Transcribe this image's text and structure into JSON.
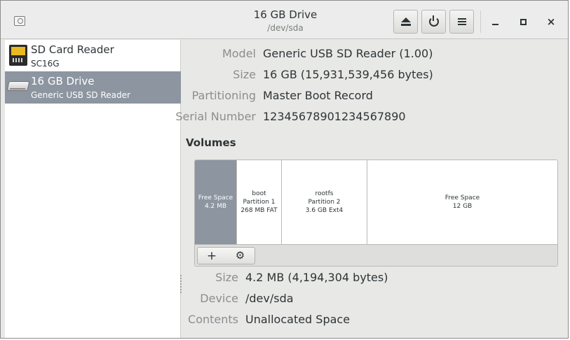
{
  "header": {
    "title": "16 GB Drive",
    "subtitle": "/dev/sda",
    "buttons": {
      "eject": "eject-icon",
      "power": "power-icon",
      "menu": "menu-icon"
    },
    "window_controls": {
      "close": "×"
    }
  },
  "sidebar": {
    "items": [
      {
        "name": "SD Card Reader",
        "sub": "SC16G",
        "icon": "sd-card-icon",
        "selected": false
      },
      {
        "name": "16 GB Drive",
        "sub": "Generic USB  SD Reader",
        "icon": "usb-drive-icon",
        "selected": true
      }
    ]
  },
  "drive": {
    "model_label": "Model",
    "model": "Generic USB  SD Reader (1.00)",
    "size_label": "Size",
    "size": "16 GB (15,931,539,456 bytes)",
    "partitioning_label": "Partitioning",
    "partitioning": "Master Boot Record",
    "serial_label": "Serial Number",
    "serial": "12345678901234567890"
  },
  "volumes": {
    "heading": "Volumes",
    "segments": [
      {
        "line1": "Free Space",
        "line2": "4.2 MB",
        "line3": "",
        "selected": true
      },
      {
        "line1": "boot",
        "line2": "Partition 1",
        "line3": "268 MB FAT",
        "selected": false
      },
      {
        "line1": "rootfs",
        "line2": "Partition 2",
        "line3": "3.6 GB Ext4",
        "selected": false
      },
      {
        "line1": "Free Space",
        "line2": "12 GB",
        "line3": "",
        "selected": false
      }
    ],
    "toolbar": {
      "add_label": "+",
      "options_label": "⚙"
    }
  },
  "selected_volume": {
    "size_label": "Size",
    "size": "4.2 MB (4,194,304 bytes)",
    "device_label": "Device",
    "device": "/dev/sda",
    "contents_label": "Contents",
    "contents": "Unallocated Space"
  },
  "colors": {
    "selection": "#8c95a0",
    "label_gray": "#8b8e8f",
    "text": "#2e3436"
  }
}
